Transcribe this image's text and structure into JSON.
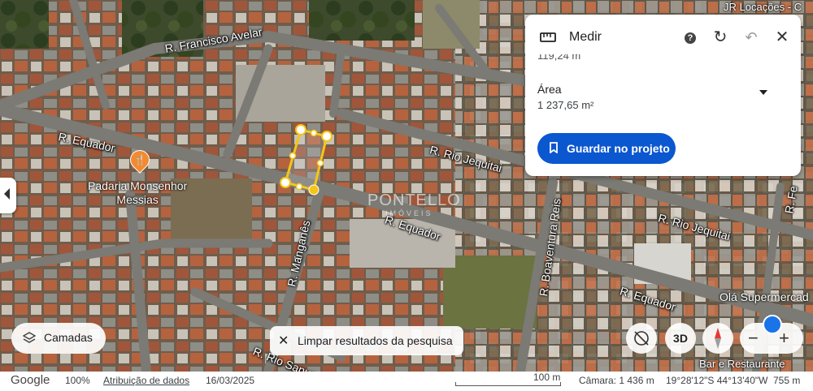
{
  "map": {
    "streets": [
      {
        "key": "francisco_avelar",
        "label": "R. Francisco Avelar"
      },
      {
        "key": "equador_left",
        "label": "R. Equador"
      },
      {
        "key": "rio_jequitai_1",
        "label": "R. Rio Jequitai"
      },
      {
        "key": "rio_jequitai_2",
        "label": "R. Rio Jequitai"
      },
      {
        "key": "equador_mid",
        "label": "R. Equador"
      },
      {
        "key": "equador_right",
        "label": "R. Equador"
      },
      {
        "key": "manganes",
        "label": "R. Manganês"
      },
      {
        "key": "boaventura_reis",
        "label": "R. Boaventura Reis"
      },
      {
        "key": "rio_sapucai",
        "label": "R. Rio Sapucaí"
      },
      {
        "key": "right_edge",
        "label": "R. Fe"
      }
    ],
    "pois": {
      "padaria": "Padaria Monsenhor\nMessias",
      "ola": "Olá Supermercad",
      "bar": "Bar e Restaurante",
      "jr": "JR Locações - C"
    },
    "watermark": "PONTELLO",
    "watermark_sub": "IMÓVEIS"
  },
  "measure_panel": {
    "title": "Medir",
    "distance_partial": "119,24 m",
    "area_label": "Área",
    "area_value": "1 237,65 m²",
    "save_button": "Guardar no projeto",
    "icons": {
      "ruler": "ruler-icon",
      "help": "help-icon",
      "redo": "redo-icon",
      "undo": "undo-icon",
      "close": "close-icon",
      "dropdown": "dropdown-icon"
    }
  },
  "controls": {
    "layers_label": "Camadas",
    "clear_search_label": "Limpar resultados da pesquisa",
    "view_3d": "3D",
    "zoom_out": "−",
    "zoom_in": "+"
  },
  "footer": {
    "google": "Google",
    "zoom_percent": "100%",
    "attribution": "Atribuição de dados",
    "date": "16/03/2025",
    "scale": "100 m",
    "camera": "Câmara: 1 436 m",
    "coords": "19°28'12\"S 44°13'40\"W",
    "elevation": "755 m"
  },
  "colors": {
    "accent": "#0b57d0",
    "measure_line": "#f5c518",
    "poi_orange": "#f28b30"
  }
}
